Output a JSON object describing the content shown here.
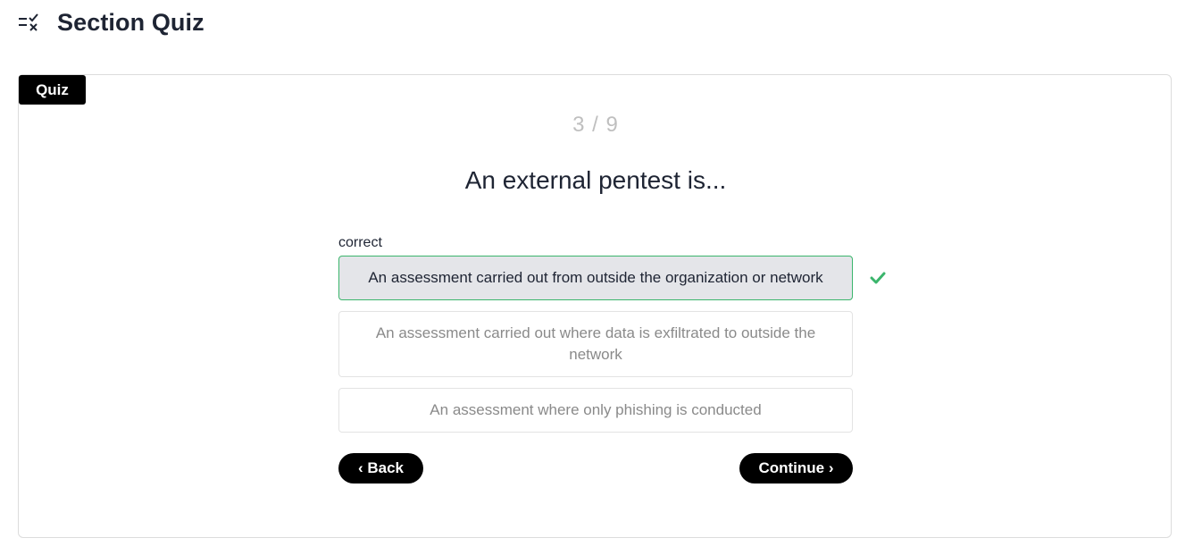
{
  "header": {
    "icon": "checklist-icon",
    "title": "Section Quiz"
  },
  "card": {
    "tag": "Quiz",
    "progress": "3 / 9",
    "question": "An external pentest is...",
    "result_label": "correct",
    "options": [
      {
        "text": "An assessment carried out from outside the organization or network",
        "state": "selected-correct"
      },
      {
        "text": "An assessment carried out where data is exfiltrated to outside the network",
        "state": "unselected"
      },
      {
        "text": "An assessment where only phishing is conducted",
        "state": "unselected"
      }
    ],
    "correct_icon": "checkmark-icon",
    "back_label": "‹ Back",
    "continue_label": "Continue ›"
  },
  "colors": {
    "correct": "#3bb56c",
    "selected_bg": "#e4e5e9",
    "button": "#000000"
  }
}
